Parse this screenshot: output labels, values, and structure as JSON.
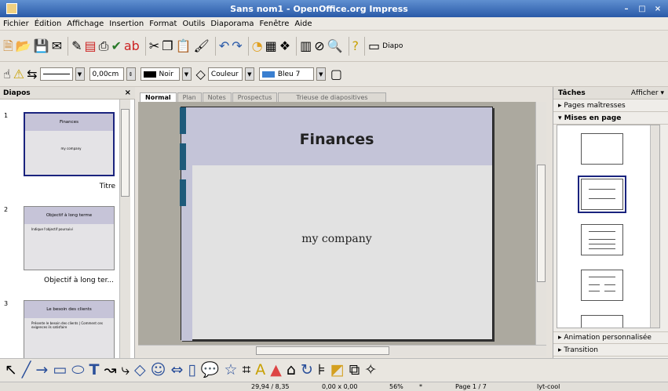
{
  "window": {
    "title": "Sans nom1 - OpenOffice.org Impress"
  },
  "menu": [
    "Fichier",
    "Édition",
    "Affichage",
    "Insertion",
    "Format",
    "Outils",
    "Diaporama",
    "Fenêtre",
    "Aide"
  ],
  "toolbar": {
    "diapo_label": "Diapo",
    "line_width": "0,00cm",
    "line_color": "Noir",
    "fill_style": "Couleur",
    "fill_color": "Bleu 7",
    "colors": {
      "line": "#000000",
      "fill": "#3a7fd0"
    }
  },
  "slides_panel": {
    "title": "Diapos",
    "slides": [
      {
        "number": "1",
        "thumb_title": "Finances",
        "thumb_body": "my company",
        "label": "Titre"
      },
      {
        "number": "2",
        "thumb_title": "Objectif à long terme",
        "thumb_body": "Indique l'objectif poursuivi",
        "label": "Objectif à long ter..."
      },
      {
        "number": "3",
        "thumb_title": "Le besoin des clients",
        "thumb_body": "Présente le besoin des clients | Comment ces exigences ils satisfaire",
        "label": ""
      }
    ]
  },
  "view_tabs": [
    "Normal",
    "Plan",
    "Notes",
    "Prospectus",
    "Trieuse de diapositives"
  ],
  "slide": {
    "title": "Finances",
    "subtitle": "my company",
    "colors": {
      "band": "#c4c4d8",
      "accent": "#1e5a7a"
    }
  },
  "task_pane": {
    "title": "Tâches",
    "view_label": "Afficher ▾",
    "sections": {
      "master": "Pages maîtresses",
      "layouts": "Mises en page",
      "animation": "Animation personnalisée",
      "transition": "Transition"
    }
  },
  "status": {
    "position": "29,94 / 8,35",
    "size": "0,00 x 0,00",
    "zoom": "56%",
    "modified": "*",
    "page": "Page 1 / 7",
    "master": "lyt-cool"
  }
}
